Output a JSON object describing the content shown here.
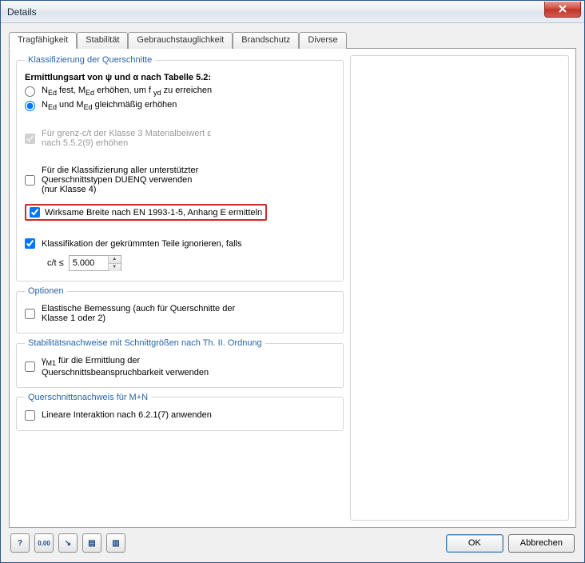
{
  "window": {
    "title": "Details"
  },
  "tabs": {
    "t0": "Tragfähigkeit",
    "t1": "Stabilität",
    "t2": "Gebrauchstauglichkeit",
    "t3": "Brandschutz",
    "t4": "Diverse"
  },
  "group_classify": {
    "legend": "Klassifizierung der Querschnitte",
    "subhead": "Ermittlungsart von ψ und α nach Tabelle 5.2:",
    "r_fixed_pre": "N",
    "r_fixed_sub1": "Ed",
    "r_fixed_mid1": " fest, M",
    "r_fixed_sub2": "Ed",
    "r_fixed_mid2": " erhöhen, um f ",
    "r_fixed_sub3": "yd",
    "r_fixed_post": " zu erreichen",
    "r_uniform_pre": "N",
    "r_uniform_sub1": "Ed",
    "r_uniform_mid": " und M",
    "r_uniform_sub2": "Ed",
    "r_uniform_post": " gleichmäßig erhöhen",
    "cb_eps_l1": "Für grenz-c/t der Klasse 3 Materialbeiwert ε",
    "cb_eps_l2": "nach 5.5.2(9) erhöhen",
    "cb_duenq_l1": "Für die Klassifizierung aller unterstützter",
    "cb_duenq_l2": "Querschnittstypen DUENQ verwenden",
    "cb_duenq_l3": "(nur Klasse 4)",
    "cb_effw": "Wirksame Breite nach EN 1993-1-5, Anhang E ermitteln",
    "cb_curved": "Klassifikation der gekrümmten Teile ignorieren, falls",
    "ct_label": "c/t ≤",
    "ct_value": "5.000"
  },
  "group_options": {
    "legend": "Optionen",
    "cb_elastic_l1": "Elastische Bemessung (auch für Querschnitte der",
    "cb_elastic_l2": "Klasse 1 oder 2)"
  },
  "group_stab": {
    "legend": "Stabilitätsnachweise mit Schnittgrößen nach Th. II. Ordnung",
    "cb_gamma_pre": "γ",
    "cb_gamma_sub": "M1",
    "cb_gamma_mid": " für die Ermittlung der",
    "cb_gamma_l2": "Querschnittsbeanspruchbarkeit verwenden"
  },
  "group_mn": {
    "legend": "Querschnittsnachweis für M+N",
    "cb_linear": "Lineare Interaktion nach 6.2.1(7) anwenden"
  },
  "iconbar": {
    "i0": "?",
    "i1": "0.00",
    "i2": "↘",
    "i3": "▤",
    "i4": "▥"
  },
  "buttons": {
    "ok": "OK",
    "cancel": "Abbrechen"
  }
}
